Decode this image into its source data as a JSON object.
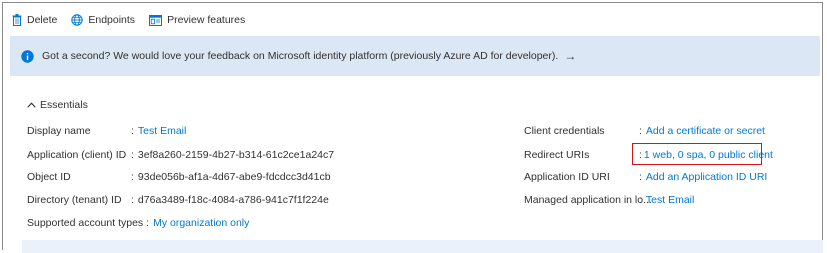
{
  "toolbar": {
    "delete_label": "Delete",
    "endpoints_label": "Endpoints",
    "preview_label": "Preview features"
  },
  "banner": {
    "message": "Got a second? We would love your feedback on Microsoft identity platform (previously Azure AD for developer).",
    "arrow": "→"
  },
  "essentials": {
    "title": "Essentials",
    "left": [
      {
        "label": "Display name",
        "value": "Test Email",
        "link": true
      },
      {
        "label": "Application (client) ID",
        "value": "3ef8a260-2159-4b27-b314-61c2ce1a24c7",
        "link": false
      },
      {
        "label": "Object ID",
        "value": "93de056b-af1a-4d67-abe9-fdcdcc3d41cb",
        "link": false
      },
      {
        "label": "Directory (tenant) ID",
        "value": "d76a3489-f18c-4084-a786-941c7f1f224e",
        "link": false
      },
      {
        "label": "Supported account types",
        "value": "My organization only",
        "link": true
      }
    ],
    "right": [
      {
        "label": "Client credentials",
        "value": "Add a certificate or secret",
        "link": true
      },
      {
        "label": "Redirect URIs",
        "value": "1 web, 0 spa, 0 public client",
        "link": true
      },
      {
        "label": "Application ID URI",
        "value": "Add an Application ID URI",
        "link": true
      },
      {
        "label": "Managed application in lo...",
        "value": "Test Email",
        "link": true
      }
    ],
    "colon": ":"
  },
  "colors": {
    "link": "#0078d4",
    "banner_bg": "#dbe7f5",
    "highlight_border": "#d4141c",
    "info_icon": "#0078d4"
  },
  "icons": {
    "delete": "trash-icon",
    "endpoints": "globe-icon",
    "preview": "preview-features-icon",
    "info": "info-icon",
    "chevron": "chevron-up-icon"
  }
}
